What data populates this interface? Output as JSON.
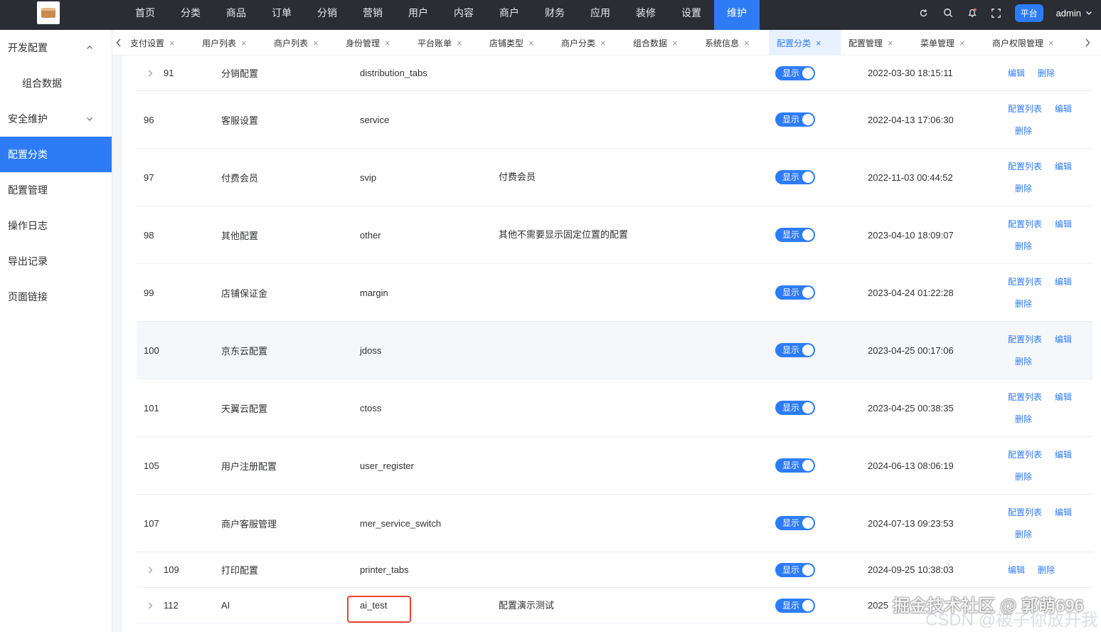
{
  "nav": [
    "首页",
    "分类",
    "商品",
    "订单",
    "分销",
    "营销",
    "用户",
    "内容",
    "商户",
    "财务",
    "应用",
    "装修",
    "设置",
    "维护"
  ],
  "top_right": {
    "badge": "平台",
    "user": "admin"
  },
  "sidebar": [
    {
      "label": "开发配置",
      "chevron": "up"
    },
    {
      "label": "组合数据",
      "sub": true
    },
    {
      "label": "安全维护",
      "chevron": "down"
    },
    {
      "label": "配置分类",
      "active": true
    },
    {
      "label": "配置管理"
    },
    {
      "label": "操作日志"
    },
    {
      "label": "导出记录"
    },
    {
      "label": "页面链接"
    }
  ],
  "tabs": [
    "支付设置",
    "用户列表",
    "商户列表",
    "身份管理",
    "平台账单",
    "店铺类型",
    "商户分类",
    "组合数据",
    "系统信息",
    "配置分类",
    "配置管理",
    "菜单管理",
    "商户权限管理"
  ],
  "active_tab": "配置分类",
  "ops_labels": {
    "list": "配置列表",
    "edit": "编辑",
    "delete": "删除"
  },
  "rows": [
    {
      "id": "91",
      "expandable": true,
      "name": "分销配置",
      "key": "distribution_tabs",
      "desc": "",
      "status": "显示",
      "time": "2022-03-30 18:15:11",
      "ops": "short"
    },
    {
      "id": "96",
      "name": "客服设置",
      "key": "service",
      "desc": "",
      "status": "显示",
      "time": "2022-04-13 17:06:30",
      "ops": "full"
    },
    {
      "id": "97",
      "name": "付费会员",
      "key": "svip",
      "desc": "付费会员",
      "status": "显示",
      "time": "2022-11-03 00:44:52",
      "ops": "full"
    },
    {
      "id": "98",
      "name": "其他配置",
      "key": "other",
      "desc": "其他不需要显示固定位置的配置",
      "status": "显示",
      "time": "2023-04-10 18:09:07",
      "ops": "full"
    },
    {
      "id": "99",
      "name": "店铺保证金",
      "key": "margin",
      "desc": "",
      "status": "显示",
      "time": "2023-04-24 01:22:28",
      "ops": "full"
    },
    {
      "id": "100",
      "name": "京东云配置",
      "key": "jdoss",
      "desc": "",
      "status": "显示",
      "time": "2023-04-25 00:17:06",
      "ops": "full",
      "highlight": true
    },
    {
      "id": "101",
      "name": "天翼云配置",
      "key": "ctoss",
      "desc": "",
      "status": "显示",
      "time": "2023-04-25 00:38:35",
      "ops": "full"
    },
    {
      "id": "105",
      "name": "用户注册配置",
      "key": "user_register",
      "desc": "",
      "status": "显示",
      "time": "2024-06-13 08:06:19",
      "ops": "full"
    },
    {
      "id": "107",
      "name": "商户客服管理",
      "key": "mer_service_switch",
      "desc": "",
      "status": "显示",
      "time": "2024-07-13 09:23:53",
      "ops": "full"
    },
    {
      "id": "109",
      "expandable": true,
      "name": "打印配置",
      "key": "printer_tabs",
      "desc": "",
      "status": "显示",
      "time": "2024-09-25 10:38:03",
      "ops": "short"
    },
    {
      "id": "112",
      "expandable": true,
      "name": "AI",
      "key": "ai_test",
      "desc": "配置演示测试",
      "status": "显示",
      "time": "2025",
      "ops": "none"
    }
  ],
  "watermark": "掘金技术社区 @ 郭萌696",
  "watermark2": "CSDN @被子你放开我"
}
